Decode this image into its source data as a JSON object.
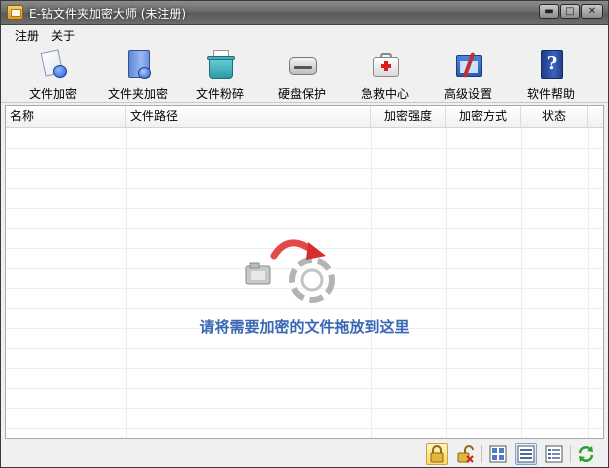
{
  "window": {
    "title": "E-钻文件夹加密大师 (未注册)",
    "controls": {
      "minimize": "▬",
      "maximize": "□",
      "close": "✕"
    }
  },
  "menu": {
    "items": [
      {
        "label": "注册"
      },
      {
        "label": "关于"
      }
    ]
  },
  "toolbar": {
    "items": [
      {
        "label": "文件加密",
        "icon": "file-lock-icon"
      },
      {
        "label": "文件夹加密",
        "icon": "folder-lock-icon"
      },
      {
        "label": "文件粉碎",
        "icon": "shredder-icon"
      },
      {
        "label": "硬盘保护",
        "icon": "hard-disk-icon"
      },
      {
        "label": "急救中心",
        "icon": "first-aid-icon"
      },
      {
        "label": "高级设置",
        "icon": "settings-tools-icon"
      },
      {
        "label": "软件帮助",
        "icon": "help-book-icon"
      }
    ]
  },
  "table": {
    "columns": [
      "名称",
      "文件路径",
      "加密强度",
      "加密方式",
      "状态"
    ],
    "rows": []
  },
  "drop_zone": {
    "text": "请将需要加密的文件拖放到这里"
  },
  "statusbar": {
    "buttons": [
      "lock-icon",
      "unlock-icon",
      "large-icons-view-icon",
      "list-view-icon",
      "details-view-icon",
      "refresh-icon"
    ],
    "selected_view": "list-view-icon"
  },
  "colors": {
    "drop_text": "#3866b3",
    "active_lock_bg": "#ffd96a"
  }
}
